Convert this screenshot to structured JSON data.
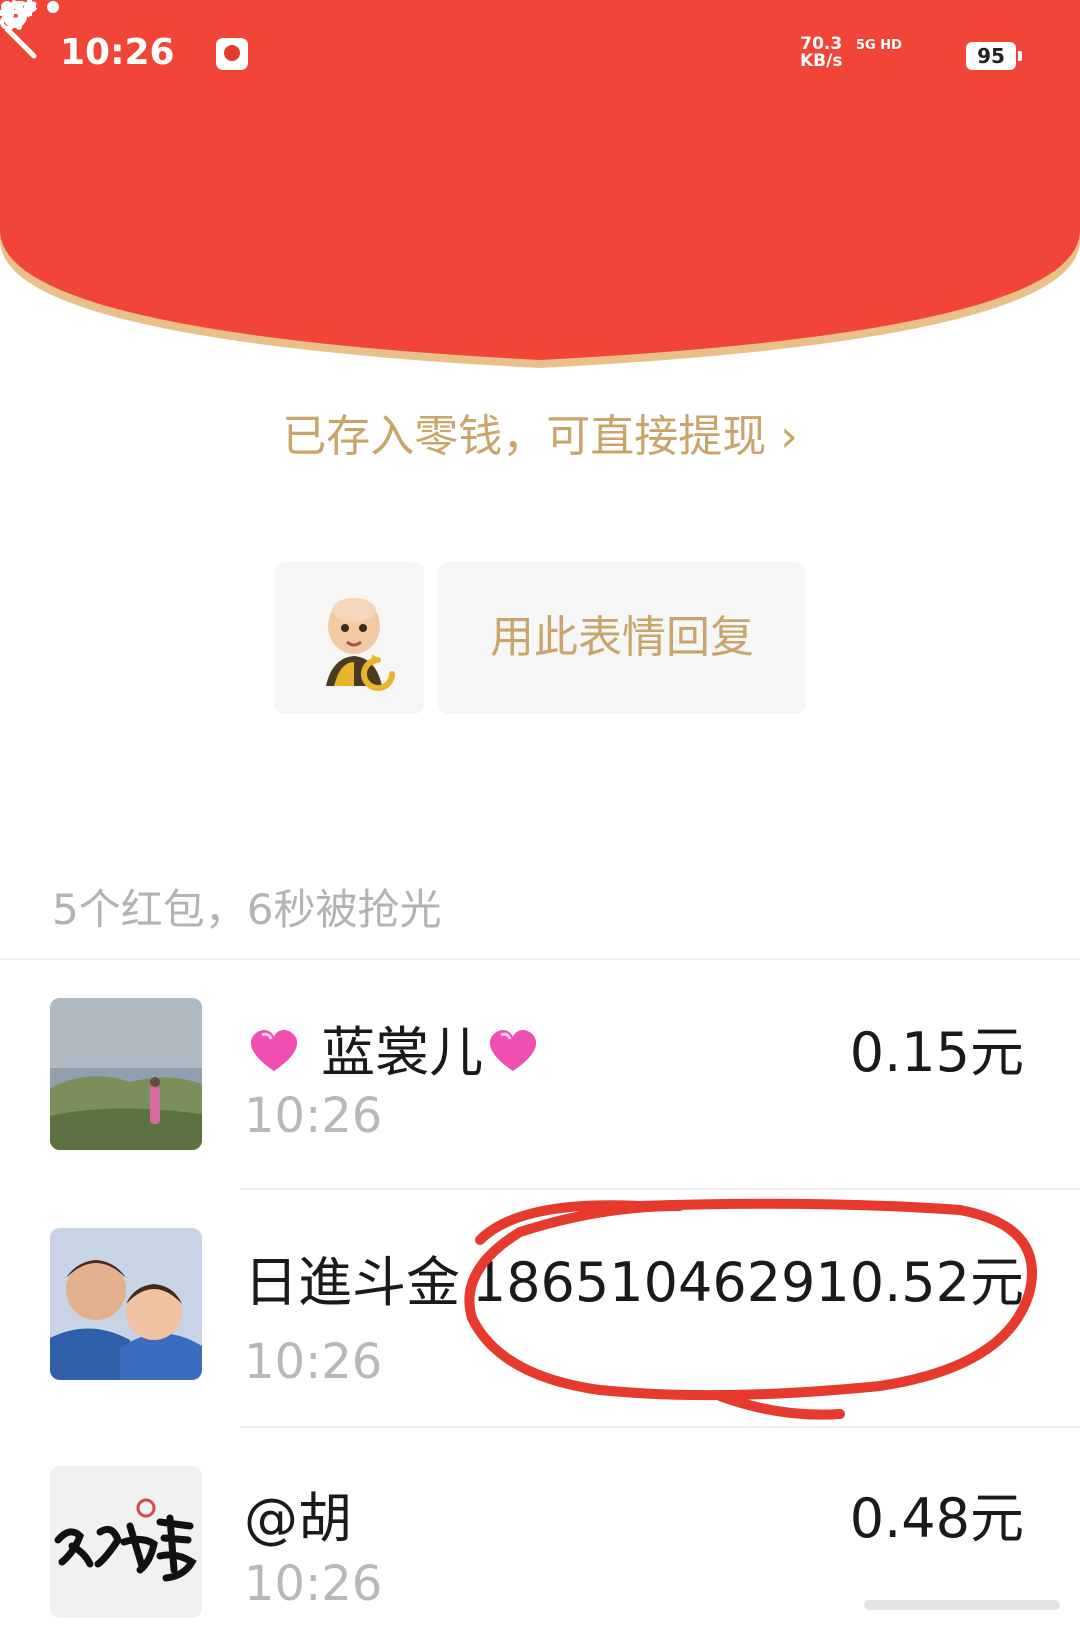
{
  "status_bar": {
    "time": "10:26",
    "net_speed_value": "70.3",
    "net_speed_unit": "KB/s",
    "network_type": "5G HD",
    "battery": "95"
  },
  "header": {
    "bg_color": "#f04537",
    "curve_border_color": "#e9c089"
  },
  "wallet_notice": "已存入零钱，可直接提现",
  "reply_button_label": "用此表情回复",
  "summary": "5个红包，6秒被抢光",
  "recipients": [
    {
      "name": "蓝裳儿",
      "time": "10:26",
      "amount": "0.15元"
    },
    {
      "name": "日進斗金",
      "time": "10:26",
      "amount": "186510462910.52元"
    },
    {
      "name": "@胡",
      "time": "10:26",
      "amount": "0.48元"
    }
  ],
  "colors": {
    "gold_text": "#c9a46b",
    "annotation_red": "#e53a2c"
  },
  "icons": [
    "back-icon",
    "more-icon",
    "tiktok-icon",
    "alarm-icon",
    "wifi-icon",
    "signal-icon",
    "refresh-icon",
    "heart-icon"
  ]
}
